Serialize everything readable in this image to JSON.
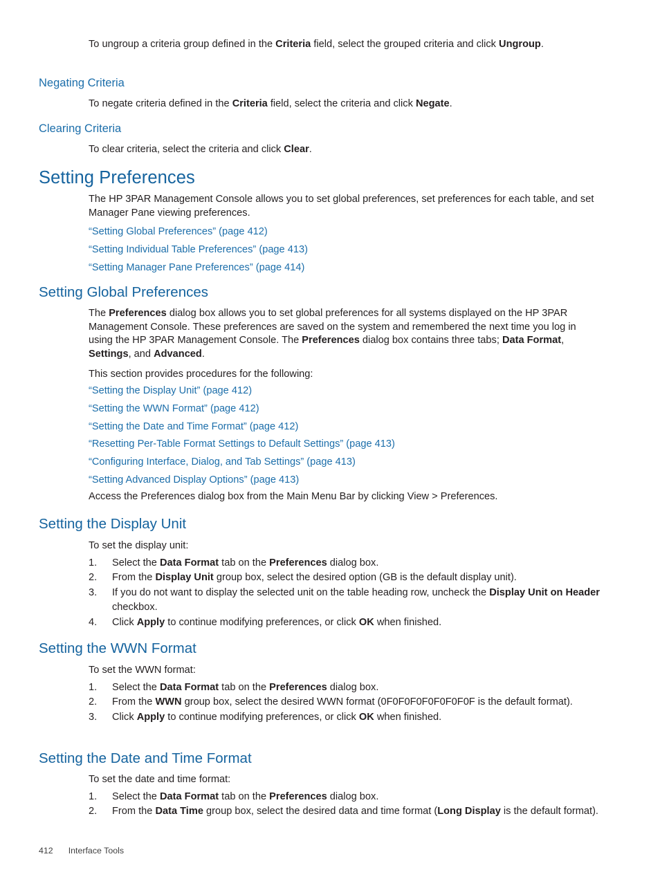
{
  "page": {
    "footer_page_number": "412",
    "footer_chapter": "Interface Tools"
  },
  "intro": {
    "ungroup_para_1": "To ungroup a criteria group defined in the ",
    "ungroup_bold_1": "Criteria",
    "ungroup_para_2": " field, select the grouped criteria and click ",
    "ungroup_bold_2": "Ungroup",
    "ungroup_para_3": "."
  },
  "negating_criteria": {
    "heading": "Negating Criteria",
    "para_1": "To negate criteria defined in the ",
    "bold_1": "Criteria",
    "para_2": " field, select the criteria and click ",
    "bold_2": "Negate",
    "para_3": "."
  },
  "clearing_criteria": {
    "heading": "Clearing Criteria",
    "para_1": "To clear criteria, select the criteria and click ",
    "bold_1": "Clear",
    "para_2": "."
  },
  "setting_preferences": {
    "heading": "Setting Preferences",
    "intro": "The HP 3PAR Management Console allows you to set global preferences, set preferences for each table, and set Manager Pane viewing preferences.",
    "links": [
      "“Setting Global Preferences” (page 412)",
      "“Setting Individual Table Preferences” (page 413)",
      "“Setting Manager Pane Preferences” (page 414)"
    ]
  },
  "setting_global_preferences": {
    "heading": "Setting Global Preferences",
    "para1_a": "The ",
    "para1_b_preferences_1": "Preferences",
    "para1_c": " dialog box allows you to set global preferences for all systems displayed on the HP 3PAR Management Console. These preferences are saved on the system and remembered the next time you log in using the HP 3PAR Management Console. The ",
    "para1_b_preferences_2": "Preferences",
    "para1_d": " dialog box contains three tabs; ",
    "para1_b_data_format": "Data Format",
    "para1_e": ", ",
    "para1_b_settings": "Settings",
    "para1_f": ", and ",
    "para1_b_advanced": "Advanced",
    "para1_g": ".",
    "para2": "This section provides procedures for the following:",
    "links": [
      "“Setting the Display Unit” (page 412)",
      "“Setting the WWN Format” (page 412)",
      "“Setting the Date and Time Format” (page 412)",
      "“Resetting Per-Table Format Settings to Default Settings” (page 413)",
      "“Configuring Interface, Dialog, and Tab Settings” (page 413)",
      "“Setting Advanced Display Options” (page 413)"
    ],
    "access_para": "Access the Preferences dialog box from the Main Menu Bar by clicking View > Preferences."
  },
  "setting_display_unit": {
    "heading": "Setting the Display Unit",
    "lead": "To set the display unit:",
    "steps": [
      {
        "num": "1.",
        "a": "Select the ",
        "b1": "Data Format",
        "c": " tab on the ",
        "b2": "Preferences",
        "d": " dialog box."
      },
      {
        "num": "2.",
        "a": "From the ",
        "b1": "Display Unit",
        "c": " group box, select the desired option (GB is the default display unit).",
        "b2": "",
        "d": ""
      },
      {
        "num": "3.",
        "a": "If you do not want to display the selected unit on the table heading row, uncheck the ",
        "b1": "Display Unit on Header",
        "c": " checkbox.",
        "b2": "",
        "d": ""
      },
      {
        "num": "4.",
        "a": "Click ",
        "b1": "Apply",
        "c": " to continue modifying preferences, or click ",
        "b2": "OK",
        "d": " when finished."
      }
    ]
  },
  "setting_wwn_format": {
    "heading": "Setting the WWN Format",
    "lead": "To set the WWN format:",
    "steps": [
      {
        "num": "1.",
        "a": "Select the ",
        "b1": "Data Format",
        "c": " tab on the ",
        "b2": "Preferences",
        "d": " dialog box."
      },
      {
        "num": "2.",
        "a": "From the ",
        "b1": "WWN",
        "c": " group box, select the desired WWN format (0F0F0F0F0F0F0F0F is the default format).",
        "b2": "",
        "d": ""
      },
      {
        "num": "3.",
        "a": "Click ",
        "b1": "Apply",
        "c": " to continue modifying preferences, or click ",
        "b2": "OK",
        "d": " when finished."
      }
    ]
  },
  "setting_date_time_format": {
    "heading": "Setting the Date and Time Format",
    "lead": "To set the date and time format:",
    "steps": [
      {
        "num": "1.",
        "a": "Select the ",
        "b1": "Data Format",
        "c": " tab on the ",
        "b2": "Preferences",
        "d": " dialog box."
      },
      {
        "num": "2.",
        "a": "From the ",
        "b1": "Data Time",
        "c": " group box, select the desired data and time format (",
        "b2": "Long Display",
        "d": " is the default format)."
      }
    ]
  },
  "colors": {
    "heading_blue": "#15639e",
    "link_blue": "#1c6eaa",
    "body_text": "#231f20",
    "footer_text": "#3f3f3f",
    "page_background": "#ffffff"
  }
}
